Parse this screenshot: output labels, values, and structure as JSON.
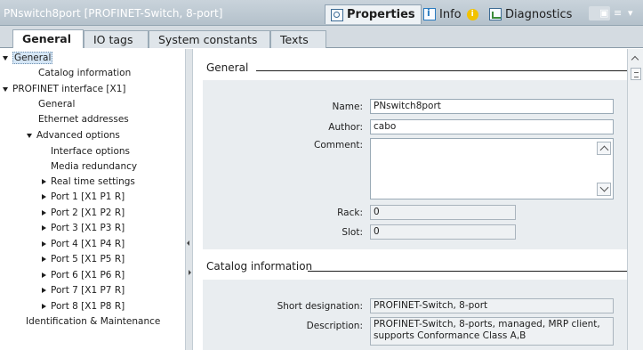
{
  "window": {
    "title": "PNswitch8port [PROFINET-Switch, 8-port]",
    "tabs": {
      "properties": "Properties",
      "info": "Info",
      "info_badge": "i",
      "diagnostics": "Diagnostics"
    }
  },
  "main_tabs": [
    "General",
    "IO tags",
    "System constants",
    "Texts"
  ],
  "tree": {
    "items": [
      {
        "label": "General",
        "expanded": true,
        "selected": true
      },
      {
        "label": "Catalog information"
      },
      {
        "label": "PROFINET interface [X1]",
        "expanded": true
      },
      {
        "label": "General"
      },
      {
        "label": "Ethernet addresses"
      },
      {
        "label": "Advanced options",
        "expanded": true
      },
      {
        "label": "Interface options"
      },
      {
        "label": "Media redundancy"
      },
      {
        "label": "Real time settings",
        "collapsed": true
      },
      {
        "label": "Port 1 [X1 P1 R]",
        "collapsed": true
      },
      {
        "label": "Port 2 [X1 P2 R]",
        "collapsed": true
      },
      {
        "label": "Port 3 [X1 P3 R]",
        "collapsed": true
      },
      {
        "label": "Port 4 [X1 P4 R]",
        "collapsed": true
      },
      {
        "label": "Port 5 [X1 P5 R]",
        "collapsed": true
      },
      {
        "label": "Port 6 [X1 P6 R]",
        "collapsed": true
      },
      {
        "label": "Port 7 [X1 P7 R]",
        "collapsed": true
      },
      {
        "label": "Port 8 [X1 P8 R]",
        "collapsed": true
      },
      {
        "label": "Identification & Maintenance"
      }
    ]
  },
  "general_section": {
    "heading": "General",
    "fields": {
      "name_label": "Name:",
      "name_value": "PNswitch8port",
      "author_label": "Author:",
      "author_value": "cabo",
      "comment_label": "Comment:",
      "comment_value": "",
      "rack_label": "Rack:",
      "rack_value": "0",
      "slot_label": "Slot:",
      "slot_value": "0"
    }
  },
  "catalog_section": {
    "heading": "Catalog information",
    "fields": {
      "short_label": "Short designation:",
      "short_value": "PROFINET-Switch, 8-port",
      "desc_label": "Description:",
      "desc_line1": "PROFINET-Switch, 8-ports, managed, MRP client,",
      "desc_line2": "supports Conformance Class A,B"
    }
  },
  "colors": {
    "titlebar": "#b4c1cb",
    "panel": "#e9edf0",
    "selection": "#d5e6f5",
    "info_badge": "#f2c200"
  }
}
